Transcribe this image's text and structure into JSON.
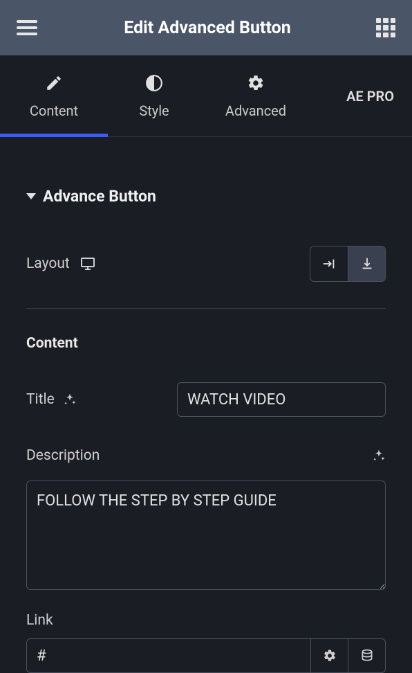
{
  "header": {
    "title": "Edit Advanced Button"
  },
  "tabs": {
    "content": "Content",
    "style": "Style",
    "advanced": "Advanced",
    "aepro": "AE PRO"
  },
  "section": {
    "title": "Advance Button"
  },
  "controls": {
    "layout_label": "Layout",
    "content_heading": "Content",
    "title_label": "Title",
    "title_value": "WATCH VIDEO",
    "description_label": "Description",
    "description_value": "FOLLOW THE STEP BY STEP GUIDE",
    "link_label": "Link",
    "link_value": "#"
  }
}
